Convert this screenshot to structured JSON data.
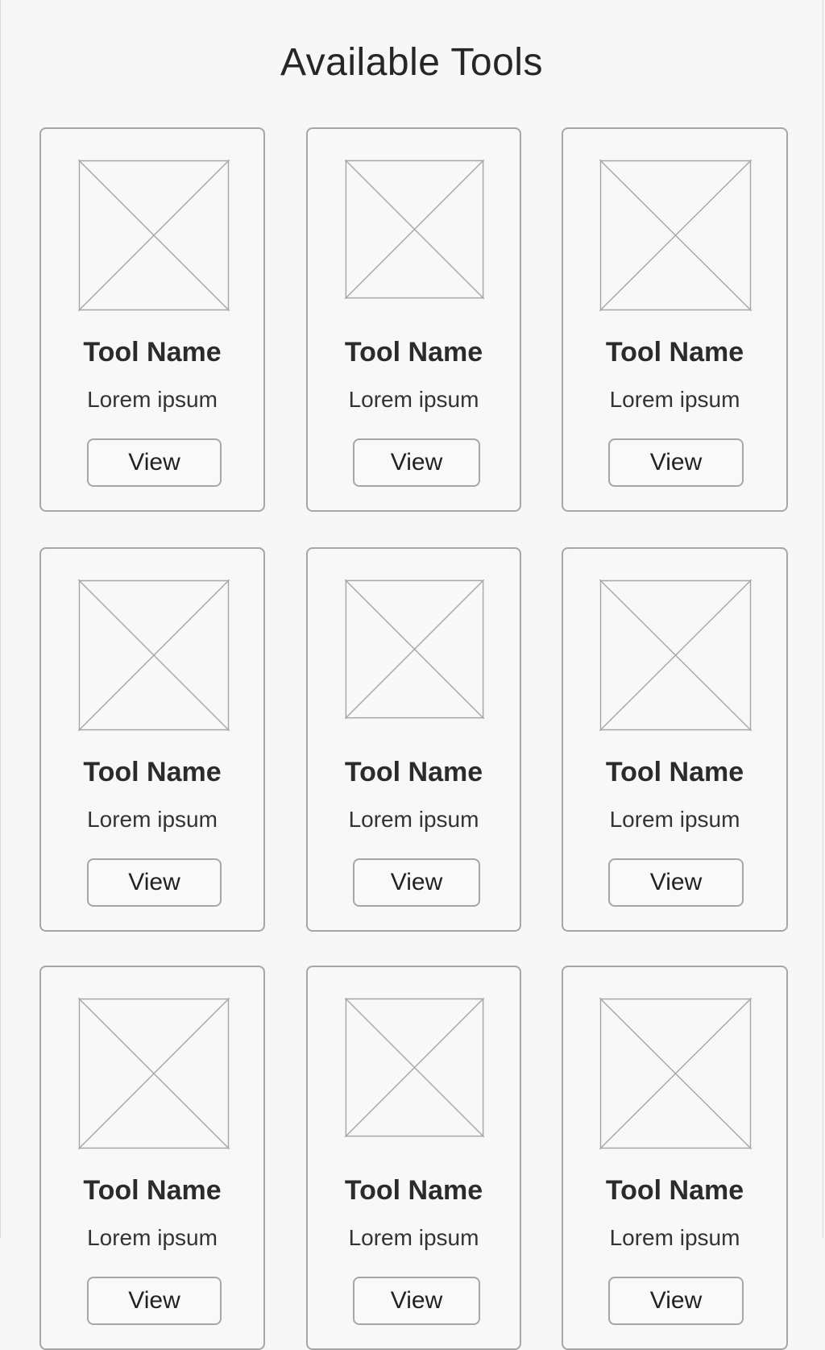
{
  "page": {
    "title": "Available Tools"
  },
  "colors": {
    "background": "#f7f7f7",
    "border": "#a6a6a6",
    "text": "#2a2a2a"
  },
  "cards": [
    {
      "name": "Tool Name",
      "description": "Lorem ipsum",
      "button_label": "View",
      "image_icon": "image-placeholder-icon"
    },
    {
      "name": "Tool Name",
      "description": "Lorem ipsum",
      "button_label": "View",
      "image_icon": "image-placeholder-icon"
    },
    {
      "name": "Tool Name",
      "description": "Lorem ipsum",
      "button_label": "View",
      "image_icon": "image-placeholder-icon"
    },
    {
      "name": "Tool Name",
      "description": "Lorem ipsum",
      "button_label": "View",
      "image_icon": "image-placeholder-icon"
    },
    {
      "name": "Tool Name",
      "description": "Lorem ipsum",
      "button_label": "View",
      "image_icon": "image-placeholder-icon"
    },
    {
      "name": "Tool Name",
      "description": "Lorem ipsum",
      "button_label": "View",
      "image_icon": "image-placeholder-icon"
    },
    {
      "name": "Tool Name",
      "description": "Lorem ipsum",
      "button_label": "View",
      "image_icon": "image-placeholder-icon"
    },
    {
      "name": "Tool Name",
      "description": "Lorem ipsum",
      "button_label": "View",
      "image_icon": "image-placeholder-icon"
    },
    {
      "name": "Tool Name",
      "description": "Lorem ipsum",
      "button_label": "View",
      "image_icon": "image-placeholder-icon"
    }
  ]
}
